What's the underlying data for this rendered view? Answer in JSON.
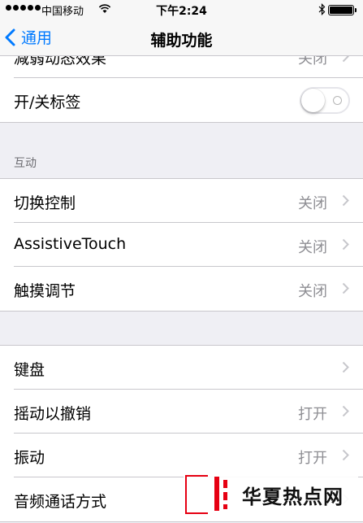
{
  "status_bar": {
    "carrier": "中国移动",
    "time": "下午2:24",
    "icons": [
      "signal-icon",
      "wifi-icon",
      "bluetooth-icon",
      "battery-icon"
    ]
  },
  "nav": {
    "back_label": "通用",
    "title": "辅助功能"
  },
  "group1": {
    "partial_row": {
      "label": "减弱动态效果",
      "value": "关闭"
    },
    "toggle_row": {
      "label": "开/关标签",
      "toggle_on": false
    }
  },
  "interaction": {
    "header": "互动",
    "rows": [
      {
        "label": "切换控制",
        "value": "关闭"
      },
      {
        "label": "AssistiveTouch",
        "value": "关闭"
      },
      {
        "label": "触摸调节",
        "value": "关闭"
      }
    ]
  },
  "group3": {
    "rows": [
      {
        "label": "键盘",
        "value": ""
      },
      {
        "label": "摇动以撤销",
        "value": "打开"
      },
      {
        "label": "振动",
        "value": "打开"
      },
      {
        "label": "音频通话方式",
        "value": ""
      }
    ]
  },
  "watermark": {
    "text": "华夏热点网"
  },
  "colors": {
    "accent": "#007aff",
    "brand_red": "#e60012"
  }
}
